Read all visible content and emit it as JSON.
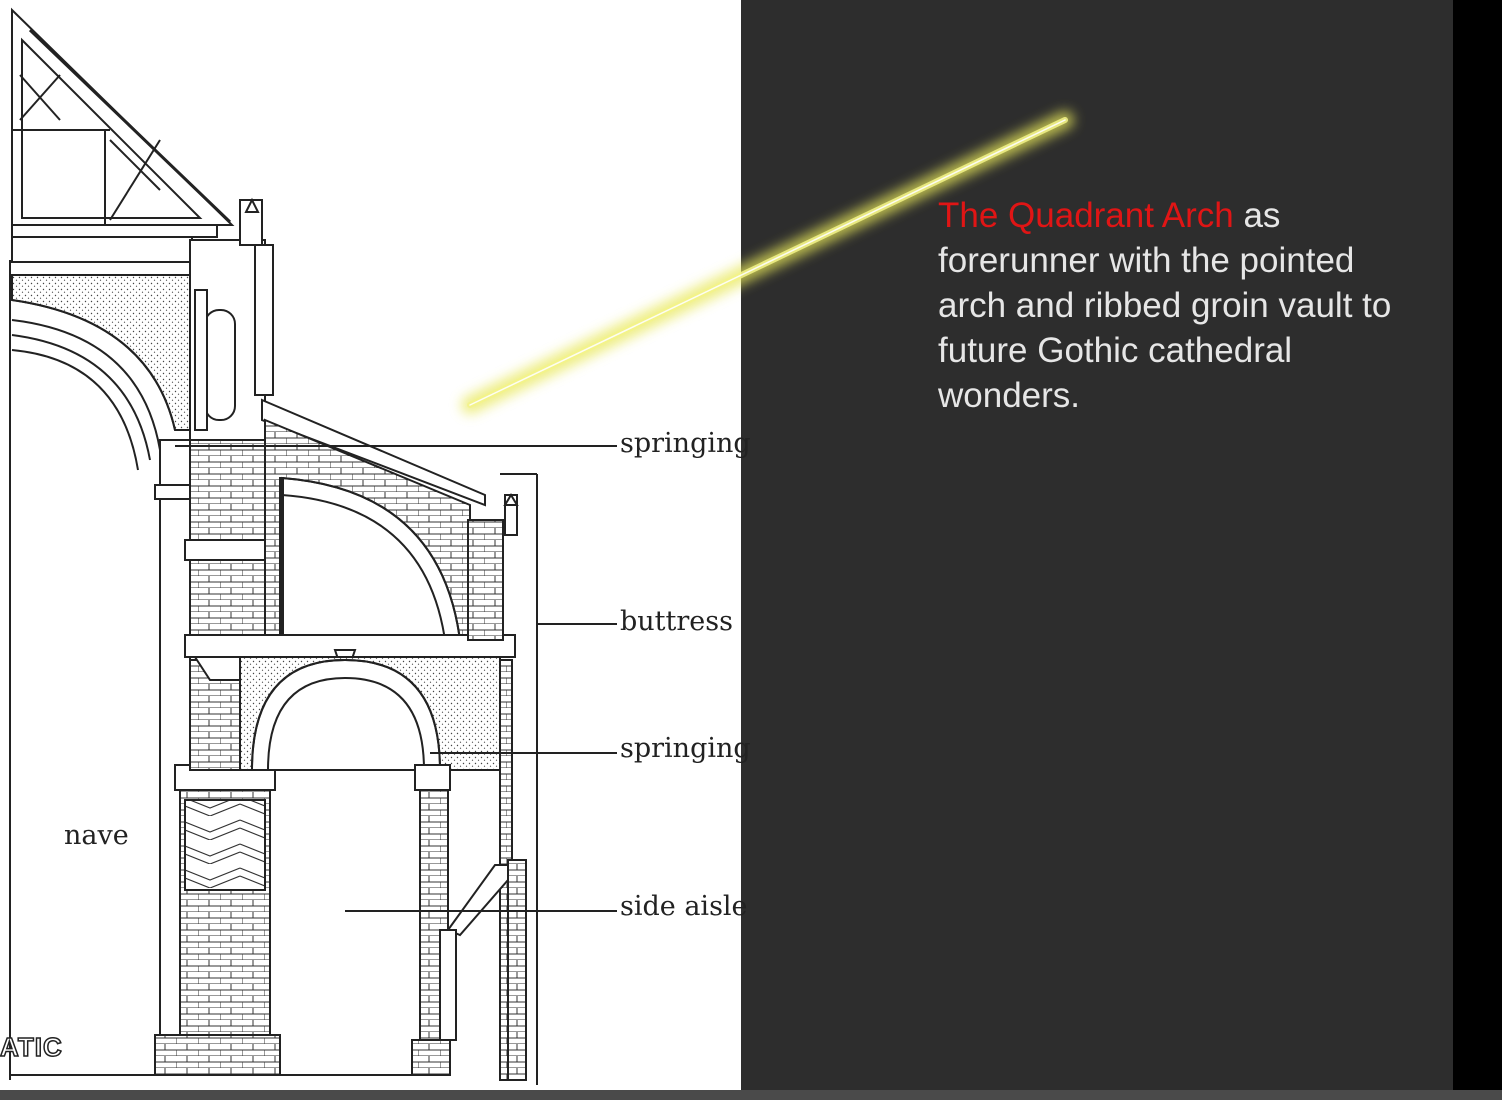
{
  "labels": {
    "nave": "nave",
    "springing_top": "springing",
    "buttress": "buttress",
    "springing_bottom": "springing",
    "side_aisle": "side aisle"
  },
  "watermark": "ATIC",
  "caption": {
    "highlight": "The Quadrant Arch",
    "rest": " as forerunner with the pointed arch and ribbed groin vault to future Gothic cathedral wonders."
  },
  "colors": {
    "caption_highlight": "#e01515",
    "caption_text": "#e6e6e6",
    "pointer_glow": "#e8e85a",
    "panel_background": "#2d2d2d"
  }
}
